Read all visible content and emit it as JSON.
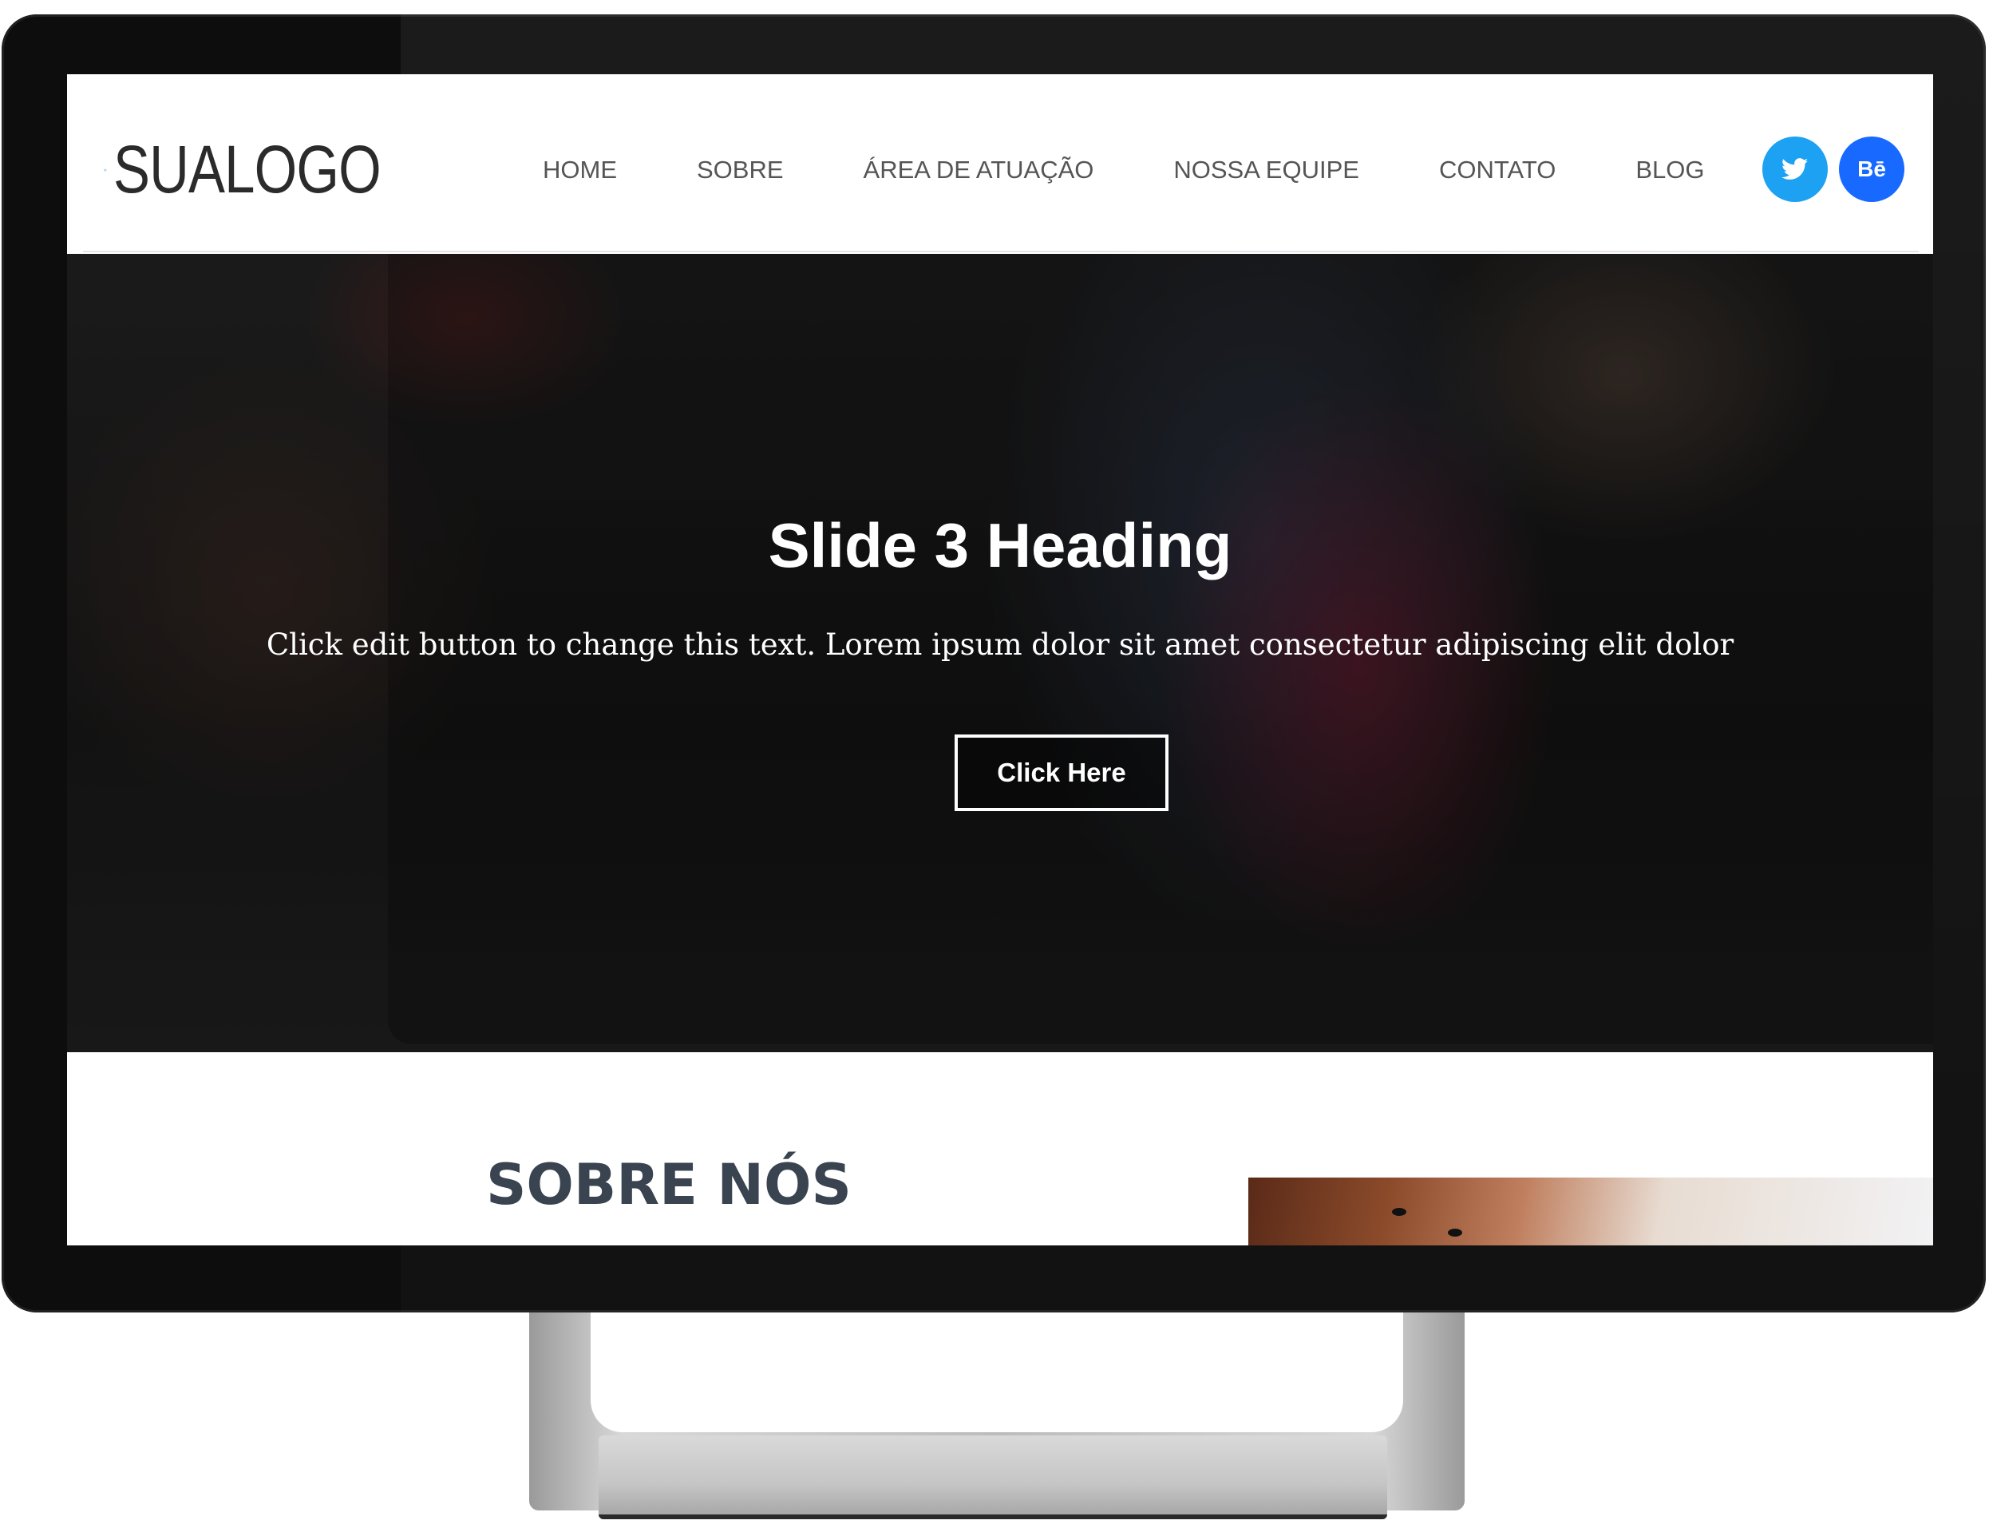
{
  "logo": {
    "text": "SUALOGO"
  },
  "nav": {
    "items": [
      {
        "label": "HOME"
      },
      {
        "label": "SOBRE"
      },
      {
        "label": "ÁREA DE ATUAÇÃO"
      },
      {
        "label": "NOSSA EQUIPE"
      },
      {
        "label": "CONTATO"
      },
      {
        "label": "BLOG"
      }
    ]
  },
  "social": {
    "twitter": {
      "icon": "twitter-icon",
      "color": "#1da1f2"
    },
    "behance": {
      "label": "Bē",
      "icon": "behance-icon",
      "color": "#1769ff"
    }
  },
  "hero": {
    "heading": "Slide 3 Heading",
    "text": "Click edit button to change this text. Lorem ipsum dolor sit amet consectetur adipiscing elit dolor",
    "button_label": "Click Here"
  },
  "about": {
    "title": "SOBRE NÓS"
  },
  "colors": {
    "accent": "#1e88e5",
    "nav_text": "#555555"
  }
}
